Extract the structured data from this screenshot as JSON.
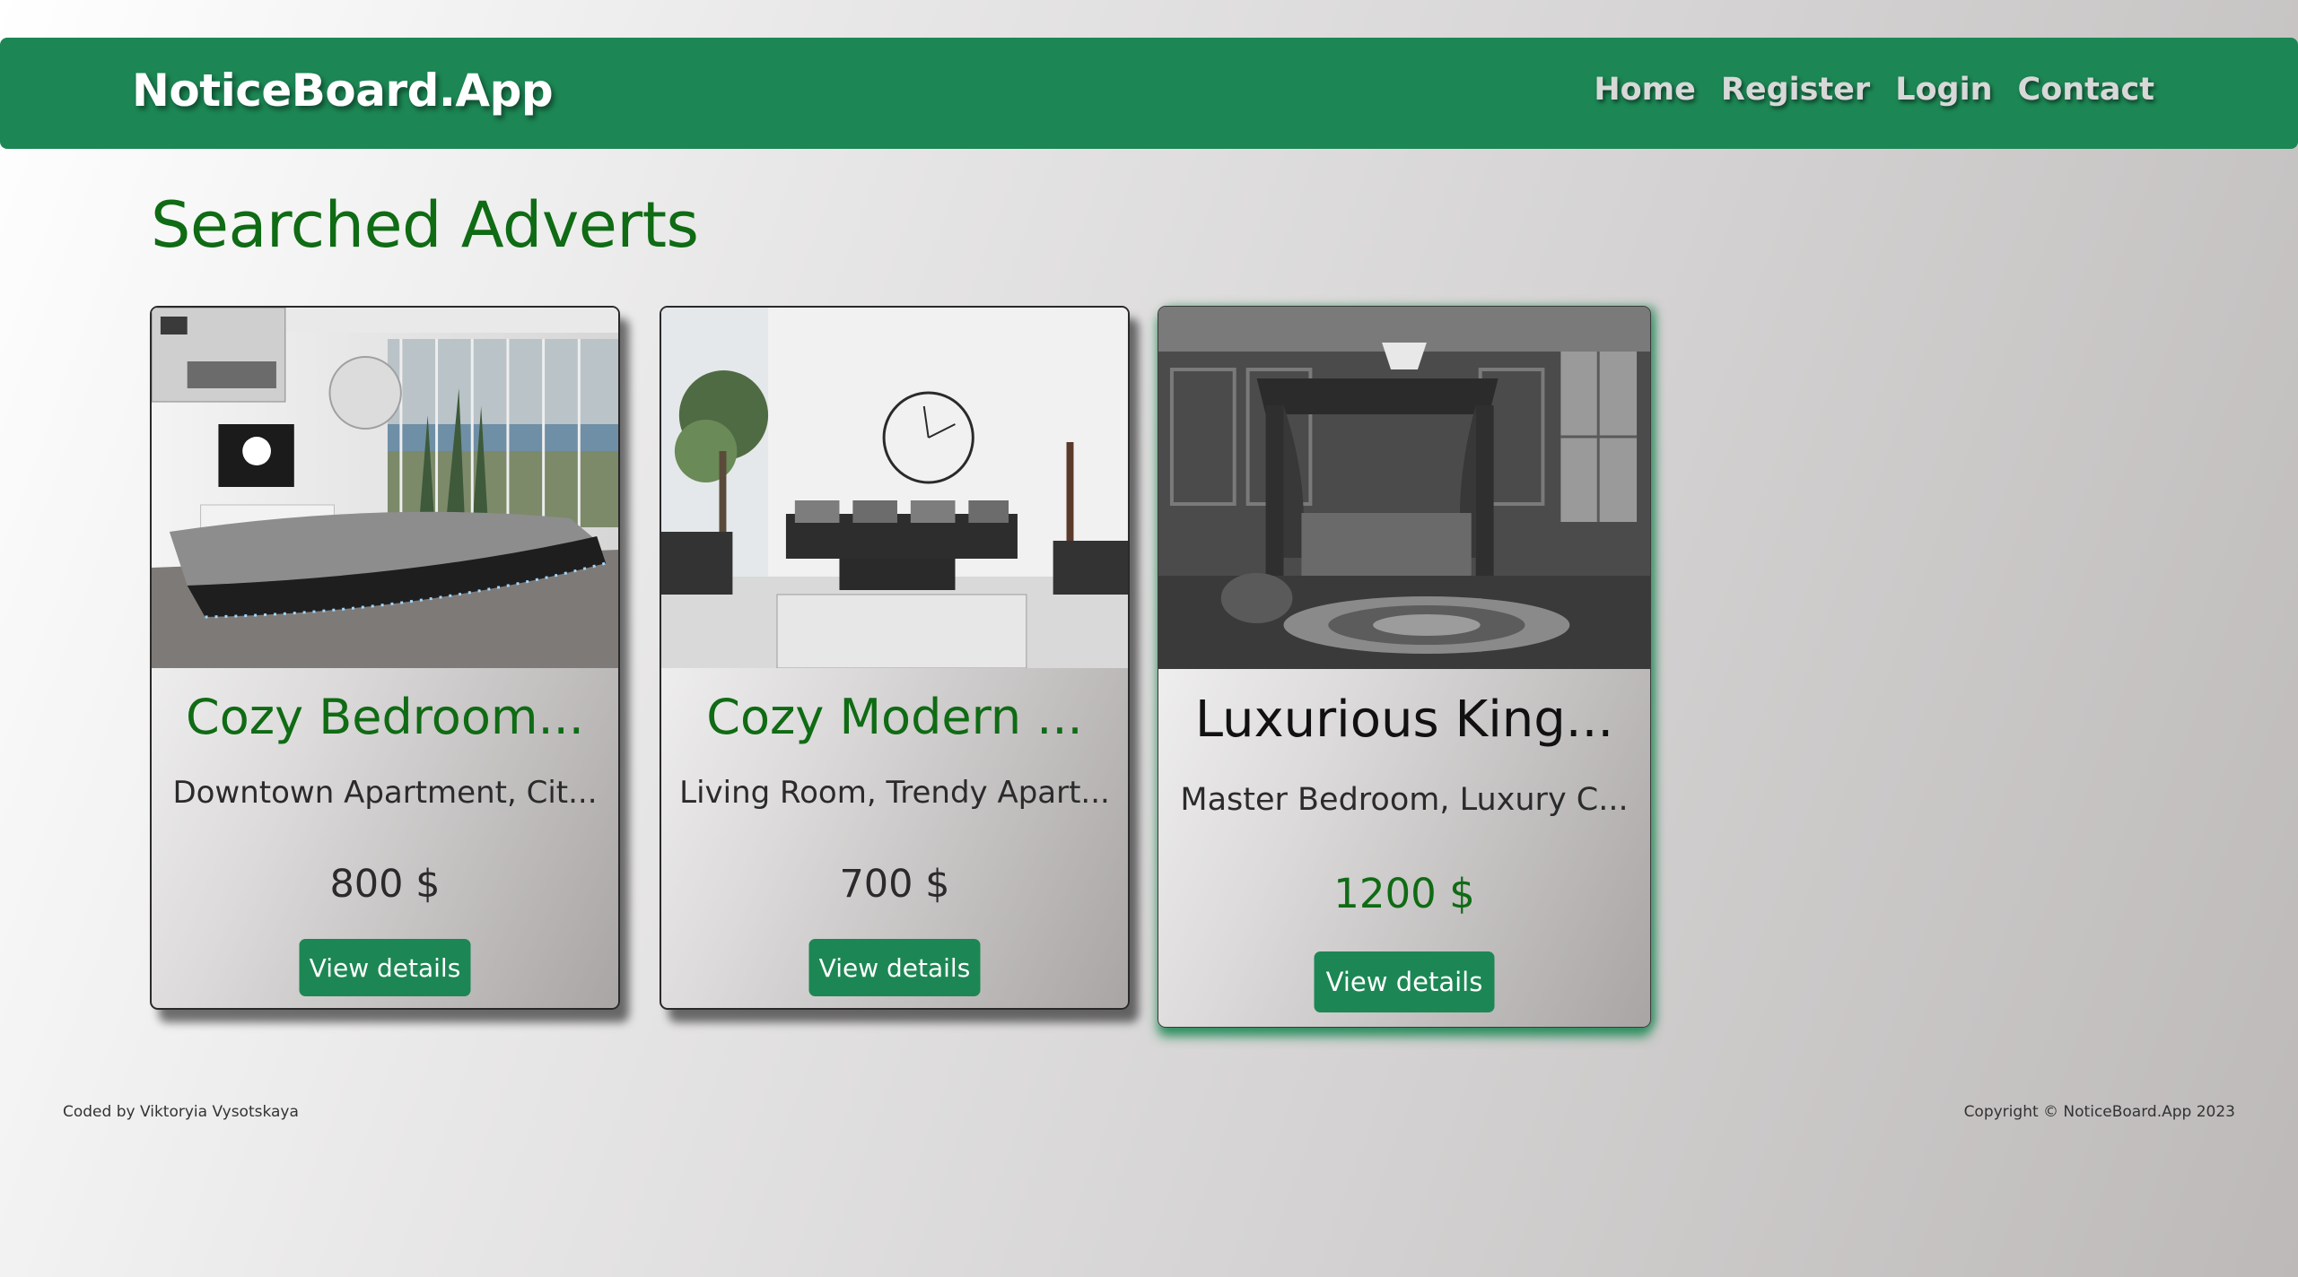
{
  "navbar": {
    "brand": "NoticeBoard.App",
    "links": [
      {
        "label": "Home"
      },
      {
        "label": "Register"
      },
      {
        "label": "Login"
      },
      {
        "label": "Contact"
      }
    ],
    "color": "#1c8754"
  },
  "main": {
    "title": "Searched Adverts",
    "cards": [
      {
        "title": "Cozy Bedroom...",
        "subtitle": "Downtown Apartment, Cit...",
        "price": "800 $",
        "button_label": "View details",
        "image": "bedroom-photo"
      },
      {
        "title": "Cozy Modern ...",
        "subtitle": "Living Room, Trendy Apart...",
        "price": "700 $",
        "button_label": "View details",
        "image": "living-room-photo"
      },
      {
        "title": "Luxurious King...",
        "subtitle": "Master Bedroom, Luxury C...",
        "price": "1200 $",
        "button_label": "View details",
        "image": "canopy-bedroom-photo",
        "highlighted": true
      }
    ]
  },
  "footer": {
    "credit": "Coded by Viktoryia Vysotskaya",
    "copyright": "Copyright © NoticeBoard.App 2023"
  },
  "colors": {
    "accent": "#1c8754",
    "title_green": "#0f6b14"
  }
}
